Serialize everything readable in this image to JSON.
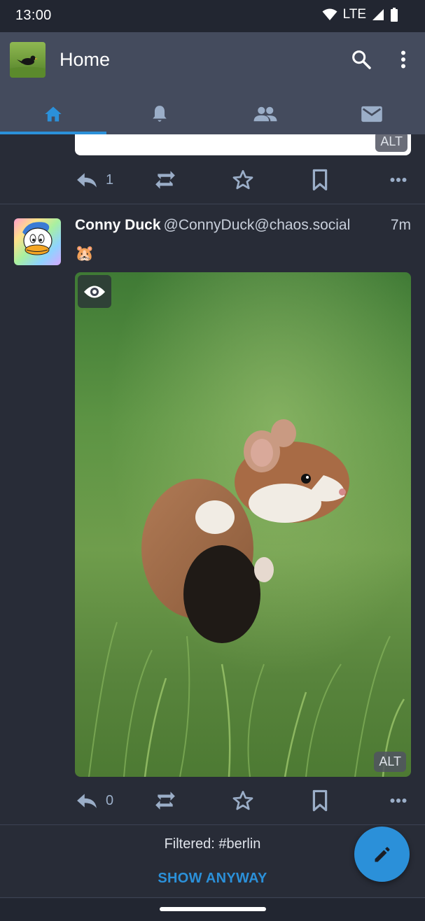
{
  "status_bar": {
    "time": "13:00",
    "network": "LTE",
    "icons": [
      "wifi-icon",
      "cellular-signal-icon",
      "battery-icon"
    ]
  },
  "app_bar": {
    "title": "Home",
    "actions": [
      "search-icon",
      "overflow-menu-icon"
    ]
  },
  "tabs": [
    {
      "icon": "home-icon",
      "active": true
    },
    {
      "icon": "notifications-bell-icon",
      "active": false
    },
    {
      "icon": "people-icon",
      "active": false
    },
    {
      "icon": "mail-icon",
      "active": false
    }
  ],
  "previous_post": {
    "media_alt_badge": "ALT",
    "reply_count": "1"
  },
  "post": {
    "display_name": "Conny Duck",
    "handle": "@ConnyDuck@chaos.social",
    "time": "7m",
    "content": "🐹",
    "media_alt_badge": "ALT",
    "reply_count": "0"
  },
  "filter_notice": {
    "text": "Filtered: #berlin",
    "action": "SHOW ANYWAY"
  },
  "colors": {
    "background": "#282c37",
    "app_bar": "#444b5d",
    "accent": "#2b90d9",
    "icon_muted": "#9baec8"
  }
}
